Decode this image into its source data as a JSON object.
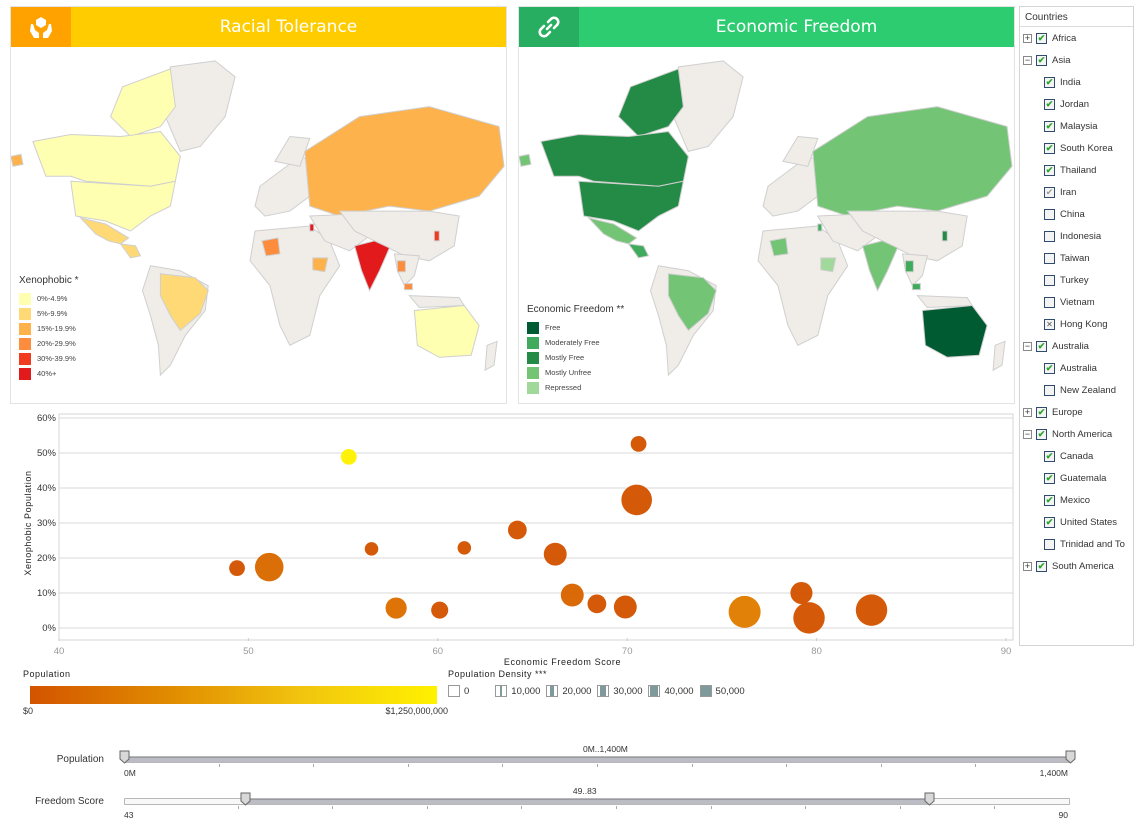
{
  "panels": {
    "racial": {
      "title": "Racial Tolerance",
      "icon": "helping-hands-icon",
      "legend_title": "Xenophobic *",
      "legend": [
        {
          "label": "0%-4.9%",
          "color": "#ffffb2"
        },
        {
          "label": "5%-9.9%",
          "color": "#fed976"
        },
        {
          "label": "15%-19.9%",
          "color": "#feb24c"
        },
        {
          "label": "20%-29.9%",
          "color": "#fd8d3c"
        },
        {
          "label": "30%-39.9%",
          "color": "#f03b20"
        },
        {
          "label": "40%+",
          "color": "#e31a1c"
        }
      ]
    },
    "econ": {
      "title": "Economic Freedom",
      "icon": "chain-link-icon",
      "legend_title": "Economic Freedom **",
      "legend": [
        {
          "label": "Free",
          "color": "#005a32"
        },
        {
          "label": "Moderately Free",
          "color": "#41ab5d"
        },
        {
          "label": "Mostly Free",
          "color": "#238b45"
        },
        {
          "label": "Mostly Unfree",
          "color": "#74c476"
        },
        {
          "label": "Repressed",
          "color": "#a1d99b"
        }
      ]
    }
  },
  "tree": {
    "header": "Countries",
    "rows": [
      {
        "type": "group",
        "label": "Africa",
        "expander": "+",
        "state": "checked"
      },
      {
        "type": "group",
        "label": "Asia",
        "expander": "−",
        "state": "checked"
      },
      {
        "type": "child",
        "label": "India",
        "state": "checked"
      },
      {
        "type": "child",
        "label": "Jordan",
        "state": "checked"
      },
      {
        "type": "child",
        "label": "Malaysia",
        "state": "checked"
      },
      {
        "type": "child",
        "label": "South Korea",
        "state": "checked"
      },
      {
        "type": "child",
        "label": "Thailand",
        "state": "checked"
      },
      {
        "type": "child",
        "label": "Iran",
        "state": "partial"
      },
      {
        "type": "child",
        "label": "China",
        "state": "unchecked"
      },
      {
        "type": "child",
        "label": "Indonesia",
        "state": "unchecked"
      },
      {
        "type": "child",
        "label": "Taiwan",
        "state": "unchecked"
      },
      {
        "type": "child",
        "label": "Turkey",
        "state": "unchecked"
      },
      {
        "type": "child",
        "label": "Vietnam",
        "state": "unchecked"
      },
      {
        "type": "child",
        "label": "Hong Kong",
        "state": "mixed"
      },
      {
        "type": "group",
        "label": "Australia",
        "expander": "−",
        "state": "checked"
      },
      {
        "type": "child",
        "label": "Australia",
        "state": "checked"
      },
      {
        "type": "child",
        "label": "New Zealand",
        "state": "unchecked"
      },
      {
        "type": "group",
        "label": "Europe",
        "expander": "+",
        "state": "checked"
      },
      {
        "type": "group",
        "label": "North America",
        "expander": "−",
        "state": "checked"
      },
      {
        "type": "child",
        "label": "Canada",
        "state": "checked"
      },
      {
        "type": "child",
        "label": "Guatemala",
        "state": "checked"
      },
      {
        "type": "child",
        "label": "Mexico",
        "state": "checked"
      },
      {
        "type": "child",
        "label": "United States",
        "state": "checked"
      },
      {
        "type": "child",
        "label": "Trinidad and To",
        "state": "unchecked"
      },
      {
        "type": "group",
        "label": "South America",
        "expander": "+",
        "state": "checked"
      }
    ]
  },
  "chart_data": {
    "type": "scatter",
    "title": "",
    "xlabel": "Economic Freedom Score",
    "ylabel": "Xenophobic Population",
    "xlim": [
      40,
      90
    ],
    "ylim": [
      0,
      60
    ],
    "x_ticks": [
      "40",
      "50",
      "60",
      "70",
      "80",
      "90"
    ],
    "x_tick_values": [
      40,
      50,
      60,
      70,
      80,
      90
    ],
    "y_ticks": [
      "0%",
      "10%",
      "20%",
      "30%",
      "40%",
      "50%",
      "60%"
    ],
    "y_tick_values": [
      0,
      10,
      20,
      30,
      40,
      50,
      60
    ],
    "grid": true,
    "size_encodes": "Population Density",
    "color_encodes": "Population",
    "points": [
      {
        "x": 49.4,
        "y": 17.1,
        "size": 8000,
        "color": "#d35400"
      },
      {
        "x": 51.1,
        "y": 17.4,
        "size": 38000,
        "color": "#d96a00"
      },
      {
        "x": 55.3,
        "y": 48.9,
        "size": 8000,
        "color": "#fff200"
      },
      {
        "x": 56.5,
        "y": 22.6,
        "size": 5000,
        "color": "#d35400"
      },
      {
        "x": 57.8,
        "y": 5.7,
        "size": 18000,
        "color": "#dd7000"
      },
      {
        "x": 60.1,
        "y": 5.1,
        "size": 10000,
        "color": "#d35400"
      },
      {
        "x": 61.4,
        "y": 22.9,
        "size": 5000,
        "color": "#d35400"
      },
      {
        "x": 64.2,
        "y": 28.0,
        "size": 13000,
        "color": "#d35400"
      },
      {
        "x": 66.2,
        "y": 21.1,
        "size": 22000,
        "color": "#d35400"
      },
      {
        "x": 67.1,
        "y": 9.4,
        "size": 22000,
        "color": "#d96400"
      },
      {
        "x": 68.4,
        "y": 6.9,
        "size": 13000,
        "color": "#d35400"
      },
      {
        "x": 69.9,
        "y": 6.0,
        "size": 22000,
        "color": "#d35400"
      },
      {
        "x": 70.6,
        "y": 52.6,
        "size": 8000,
        "color": "#d35400"
      },
      {
        "x": 70.5,
        "y": 36.6,
        "size": 45000,
        "color": "#d35400"
      },
      {
        "x": 76.2,
        "y": 4.6,
        "size": 50000,
        "color": "#e07d00"
      },
      {
        "x": 79.2,
        "y": 10.0,
        "size": 20000,
        "color": "#d35400"
      },
      {
        "x": 79.6,
        "y": 2.9,
        "size": 48000,
        "color": "#d35400"
      },
      {
        "x": 82.9,
        "y": 5.1,
        "size": 48000,
        "color": "#d35400"
      }
    ]
  },
  "legends": {
    "population": {
      "title": "Population",
      "min_label": "$0",
      "max_label": "$1,250,000,000",
      "color_from": "#d35400",
      "color_to": "#fff200"
    },
    "density": {
      "title": "Population Density ***",
      "items": [
        {
          "label": "0",
          "fill": 0
        },
        {
          "label": "10,000",
          "fill": 0.2
        },
        {
          "label": "20,000",
          "fill": 0.4
        },
        {
          "label": "30,000",
          "fill": 0.6
        },
        {
          "label": "40,000",
          "fill": 0.8
        },
        {
          "label": "50,000",
          "fill": 1.0
        }
      ]
    }
  },
  "sliders": {
    "population": {
      "label": "Population",
      "min": 0,
      "max": 1400,
      "low": 0,
      "high": 1400,
      "min_label": "0M",
      "max_label": "1,400M",
      "range_label": "0M..1,400M"
    },
    "freedom": {
      "label": "Freedom Score",
      "min": 43,
      "max": 90,
      "low": 49,
      "high": 83,
      "min_label": "43",
      "max_label": "90",
      "range_label": "49..83"
    }
  }
}
